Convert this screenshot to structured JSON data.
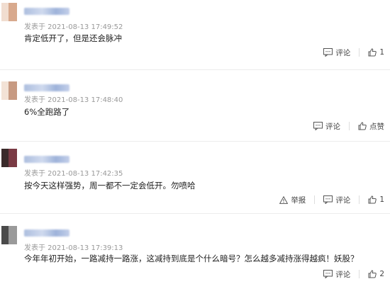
{
  "comments": [
    {
      "meta": "发表于 2021-08-13 17:49:52",
      "text": "肯定低开了，但是还会脉冲",
      "report_label": "",
      "reply_label": "评论",
      "like_label": "1",
      "avatar_colors": [
        "#f1ddd0",
        "#d8a98d"
      ]
    },
    {
      "meta": "发表于 2021-08-13 17:48:40",
      "text": "6%全跑路了",
      "report_label": "",
      "reply_label": "评论",
      "like_label": "点赞",
      "avatar_colors": [
        "#f3e2d6",
        "#c79a82"
      ]
    },
    {
      "meta": "发表于 2021-08-13 17:42:35",
      "text": "按今天这样强势，周一都不一定会低开。勿喷哈",
      "report_label": "举报",
      "reply_label": "评论",
      "like_label": "1",
      "avatar_colors": [
        "#3a2a2a",
        "#7a3a44"
      ]
    },
    {
      "meta": "发表于 2021-08-13 17:39:13",
      "text": "今年年初开始，一路减持一路涨，这减持到底是个什么暗号？怎么越多减持涨得越疯！妖股？",
      "report_label": "",
      "reply_label": "评论",
      "like_label": "2",
      "avatar_colors": [
        "#4a4a4a",
        "#9a9a9a"
      ]
    }
  ]
}
